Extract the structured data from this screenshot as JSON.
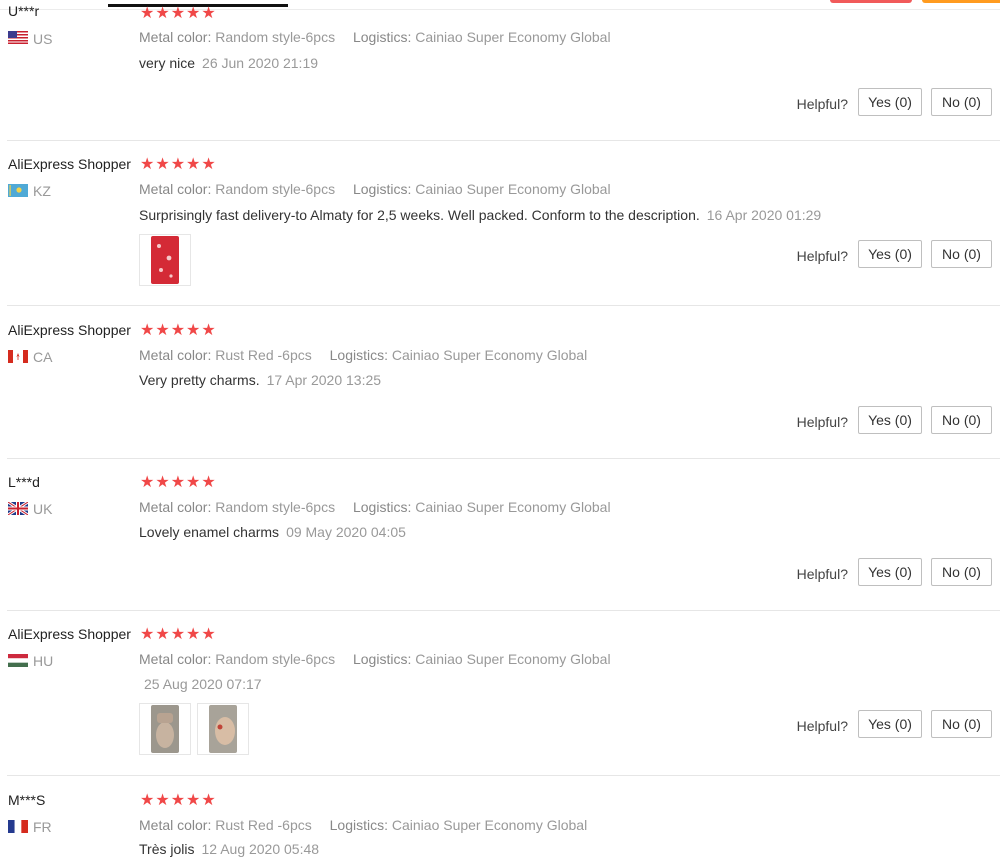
{
  "colors": {
    "star": "#f04848",
    "divider": "#e6e6e6"
  },
  "labels": {
    "metal_color": "Metal color:",
    "logistics": "Logistics:",
    "helpful": "Helpful?",
    "yes": "Yes (0)",
    "no": "No (0)"
  },
  "reviews": [
    {
      "user": "U***r",
      "country": "US",
      "flag": "us-flag-icon",
      "stars": 5,
      "metal_color": "Random style-6pcs",
      "logistics": "Cainiao Super Economy Global",
      "comment": "very nice",
      "date": "26 Jun 2020 21:19"
    },
    {
      "user": "AliExpress Shopper",
      "country": "KZ",
      "flag": "kz-flag-icon",
      "stars": 5,
      "metal_color": "Random style-6pcs",
      "logistics": "Cainiao Super Economy Global",
      "comment": "Surprisingly fast delivery-to Almaty for 2,5 weeks. Well packed. Conform to the description.",
      "date": "16 Apr 2020 01:29",
      "photos": 1
    },
    {
      "user": "AliExpress Shopper",
      "country": "CA",
      "flag": "ca-flag-icon",
      "stars": 5,
      "metal_color": "Rust Red -6pcs",
      "logistics": "Cainiao Super Economy Global",
      "comment": "Very pretty charms.",
      "date": "17 Apr 2020 13:25"
    },
    {
      "user": "L***d",
      "country": "UK",
      "flag": "uk-flag-icon",
      "stars": 5,
      "metal_color": "Random style-6pcs",
      "logistics": "Cainiao Super Economy Global",
      "comment": "Lovely enamel charms",
      "date": "09 May 2020 04:05"
    },
    {
      "user": "AliExpress Shopper",
      "country": "HU",
      "flag": "hu-flag-icon",
      "stars": 5,
      "metal_color": "Random style-6pcs",
      "logistics": "Cainiao Super Economy Global",
      "comment": "",
      "date": "25 Aug 2020 07:17",
      "photos": 2
    },
    {
      "user": "M***S",
      "country": "FR",
      "flag": "fr-flag-icon",
      "stars": 5,
      "metal_color": "Rust Red -6pcs",
      "logistics": "Cainiao Super Economy Global",
      "comment": "Très jolis",
      "date": "12 Aug 2020 05:48"
    }
  ]
}
